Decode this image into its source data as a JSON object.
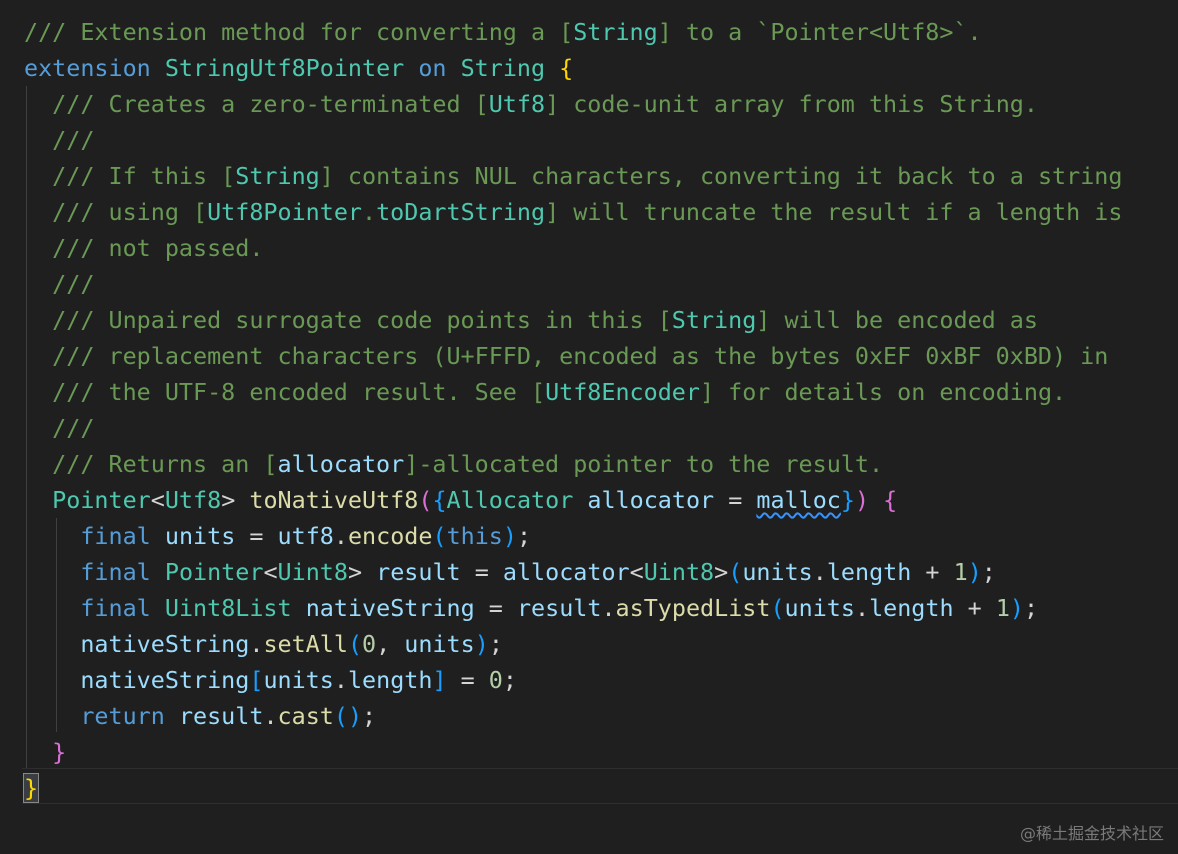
{
  "code_lines": [
    {
      "tokens": [
        {
          "t": "/// Extension method for converting a [",
          "k": "comment"
        },
        {
          "t": "String",
          "k": "ref"
        },
        {
          "t": "] to a `Pointer<Utf8>`.",
          "k": "comment"
        }
      ]
    },
    {
      "tokens": [
        {
          "t": "extension ",
          "k": "keyword"
        },
        {
          "t": "StringUtf8Pointer",
          "k": "type"
        },
        {
          "t": " on ",
          "k": "keyword"
        },
        {
          "t": "String",
          "k": "type"
        },
        {
          "t": " ",
          "k": "plain"
        },
        {
          "t": "{",
          "k": "paren-gold"
        }
      ]
    },
    {
      "tokens": [
        {
          "t": "  /// Creates a zero-terminated [",
          "k": "comment"
        },
        {
          "t": "Utf8",
          "k": "ref"
        },
        {
          "t": "] code-unit array from this String.",
          "k": "comment"
        }
      ]
    },
    {
      "tokens": [
        {
          "t": "  ///",
          "k": "comment"
        }
      ]
    },
    {
      "tokens": [
        {
          "t": "  /// If this [",
          "k": "comment"
        },
        {
          "t": "String",
          "k": "ref"
        },
        {
          "t": "] contains NUL characters, converting it back to a string",
          "k": "comment"
        }
      ]
    },
    {
      "tokens": [
        {
          "t": "  /// using [",
          "k": "comment"
        },
        {
          "t": "Utf8Pointer",
          "k": "ref"
        },
        {
          "t": ".",
          "k": "comment"
        },
        {
          "t": "toDartString",
          "k": "ref"
        },
        {
          "t": "] will truncate the result if a length is",
          "k": "comment"
        }
      ]
    },
    {
      "tokens": [
        {
          "t": "  /// not passed.",
          "k": "comment"
        }
      ]
    },
    {
      "tokens": [
        {
          "t": "  ///",
          "k": "comment"
        }
      ]
    },
    {
      "tokens": [
        {
          "t": "  /// Unpaired surrogate code points in this [",
          "k": "comment"
        },
        {
          "t": "String",
          "k": "ref"
        },
        {
          "t": "] will be encoded as",
          "k": "comment"
        }
      ]
    },
    {
      "tokens": [
        {
          "t": "  /// replacement characters (U+FFFD, encoded as the bytes 0xEF 0xBF 0xBD) in",
          "k": "comment"
        }
      ]
    },
    {
      "tokens": [
        {
          "t": "  /// the UTF-8 encoded result. See [",
          "k": "comment"
        },
        {
          "t": "Utf8Encoder",
          "k": "ref"
        },
        {
          "t": "] for details on encoding.",
          "k": "comment"
        }
      ]
    },
    {
      "tokens": [
        {
          "t": "  ///",
          "k": "comment"
        }
      ]
    },
    {
      "tokens": [
        {
          "t": "  /// Returns an [",
          "k": "comment"
        },
        {
          "t": "allocator",
          "k": "var"
        },
        {
          "t": "]-allocated pointer to the result.",
          "k": "comment"
        }
      ]
    },
    {
      "tokens": [
        {
          "t": "  ",
          "k": "plain"
        },
        {
          "t": "Pointer",
          "k": "type"
        },
        {
          "t": "<",
          "k": "plain"
        },
        {
          "t": "Utf8",
          "k": "type"
        },
        {
          "t": "> ",
          "k": "plain"
        },
        {
          "t": "toNativeUtf8",
          "k": "func"
        },
        {
          "t": "(",
          "k": "paren-pink"
        },
        {
          "t": "{",
          "k": "paren-blue"
        },
        {
          "t": "Allocator",
          "k": "type"
        },
        {
          "t": " ",
          "k": "plain"
        },
        {
          "t": "allocator",
          "k": "var"
        },
        {
          "t": " = ",
          "k": "plain"
        },
        {
          "t": "malloc",
          "k": "squiggle"
        },
        {
          "t": "}",
          "k": "paren-blue"
        },
        {
          "t": ")",
          "k": "paren-pink"
        },
        {
          "t": " ",
          "k": "plain"
        },
        {
          "t": "{",
          "k": "paren-pink"
        }
      ]
    },
    {
      "tokens": [
        {
          "t": "    ",
          "k": "plain"
        },
        {
          "t": "final",
          "k": "keyword"
        },
        {
          "t": " ",
          "k": "plain"
        },
        {
          "t": "units",
          "k": "var"
        },
        {
          "t": " = ",
          "k": "plain"
        },
        {
          "t": "utf8",
          "k": "var"
        },
        {
          "t": ".",
          "k": "plain"
        },
        {
          "t": "encode",
          "k": "func"
        },
        {
          "t": "(",
          "k": "paren-blue"
        },
        {
          "t": "this",
          "k": "keyword"
        },
        {
          "t": ")",
          "k": "paren-blue"
        },
        {
          "t": ";",
          "k": "plain"
        }
      ]
    },
    {
      "tokens": [
        {
          "t": "    ",
          "k": "plain"
        },
        {
          "t": "final",
          "k": "keyword"
        },
        {
          "t": " ",
          "k": "plain"
        },
        {
          "t": "Pointer",
          "k": "type"
        },
        {
          "t": "<",
          "k": "plain"
        },
        {
          "t": "Uint8",
          "k": "type"
        },
        {
          "t": "> ",
          "k": "plain"
        },
        {
          "t": "result",
          "k": "var"
        },
        {
          "t": " = ",
          "k": "plain"
        },
        {
          "t": "allocator",
          "k": "var"
        },
        {
          "t": "<",
          "k": "plain"
        },
        {
          "t": "Uint8",
          "k": "type"
        },
        {
          "t": ">",
          "k": "plain"
        },
        {
          "t": "(",
          "k": "paren-blue"
        },
        {
          "t": "units",
          "k": "var"
        },
        {
          "t": ".",
          "k": "plain"
        },
        {
          "t": "length",
          "k": "var"
        },
        {
          "t": " + ",
          "k": "plain"
        },
        {
          "t": "1",
          "k": "number"
        },
        {
          "t": ")",
          "k": "paren-blue"
        },
        {
          "t": ";",
          "k": "plain"
        }
      ]
    },
    {
      "tokens": [
        {
          "t": "    ",
          "k": "plain"
        },
        {
          "t": "final",
          "k": "keyword"
        },
        {
          "t": " ",
          "k": "plain"
        },
        {
          "t": "Uint8List",
          "k": "type"
        },
        {
          "t": " ",
          "k": "plain"
        },
        {
          "t": "nativeString",
          "k": "var"
        },
        {
          "t": " = ",
          "k": "plain"
        },
        {
          "t": "result",
          "k": "var"
        },
        {
          "t": ".",
          "k": "plain"
        },
        {
          "t": "asTypedList",
          "k": "func"
        },
        {
          "t": "(",
          "k": "paren-blue"
        },
        {
          "t": "units",
          "k": "var"
        },
        {
          "t": ".",
          "k": "plain"
        },
        {
          "t": "length",
          "k": "var"
        },
        {
          "t": " + ",
          "k": "plain"
        },
        {
          "t": "1",
          "k": "number"
        },
        {
          "t": ")",
          "k": "paren-blue"
        },
        {
          "t": ";",
          "k": "plain"
        }
      ]
    },
    {
      "tokens": [
        {
          "t": "    ",
          "k": "plain"
        },
        {
          "t": "nativeString",
          "k": "var"
        },
        {
          "t": ".",
          "k": "plain"
        },
        {
          "t": "setAll",
          "k": "func"
        },
        {
          "t": "(",
          "k": "paren-blue"
        },
        {
          "t": "0",
          "k": "number"
        },
        {
          "t": ", ",
          "k": "plain"
        },
        {
          "t": "units",
          "k": "var"
        },
        {
          "t": ")",
          "k": "paren-blue"
        },
        {
          "t": ";",
          "k": "plain"
        }
      ]
    },
    {
      "tokens": [
        {
          "t": "    ",
          "k": "plain"
        },
        {
          "t": "nativeString",
          "k": "var"
        },
        {
          "t": "[",
          "k": "paren-blue"
        },
        {
          "t": "units",
          "k": "var"
        },
        {
          "t": ".",
          "k": "plain"
        },
        {
          "t": "length",
          "k": "var"
        },
        {
          "t": "]",
          "k": "paren-blue"
        },
        {
          "t": " = ",
          "k": "plain"
        },
        {
          "t": "0",
          "k": "number"
        },
        {
          "t": ";",
          "k": "plain"
        }
      ]
    },
    {
      "tokens": [
        {
          "t": "    ",
          "k": "plain"
        },
        {
          "t": "return",
          "k": "keyword"
        },
        {
          "t": " ",
          "k": "plain"
        },
        {
          "t": "result",
          "k": "var"
        },
        {
          "t": ".",
          "k": "plain"
        },
        {
          "t": "cast",
          "k": "func"
        },
        {
          "t": "()",
          "k": "paren-blue"
        },
        {
          "t": ";",
          "k": "plain"
        }
      ]
    },
    {
      "tokens": [
        {
          "t": "  ",
          "k": "plain"
        },
        {
          "t": "}",
          "k": "paren-pink"
        }
      ]
    },
    {
      "tokens": [
        {
          "t": "}",
          "k": "brace-match"
        }
      ]
    }
  ],
  "watermark": "@稀土掘金技术社区",
  "colors": {
    "background": "#1f1f1f",
    "comment": "#6a9955",
    "reference": "#4ec9b0",
    "keyword": "#569cd6",
    "type": "#4ec9b0",
    "function": "#dcdcaa",
    "variable": "#9cdcfe",
    "number": "#b5cea8",
    "bracket_gold": "#ffd700",
    "bracket_pink": "#da70d6",
    "bracket_blue": "#179fff"
  }
}
